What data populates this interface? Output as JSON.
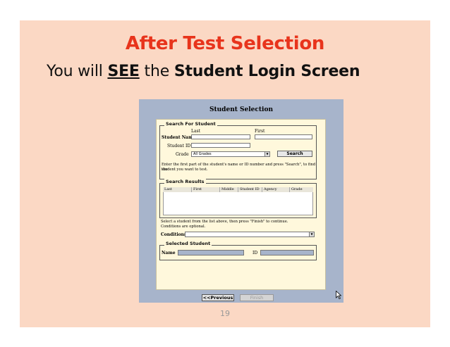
{
  "slide": {
    "title": "After Test Selection",
    "subtitle": {
      "prefix": "You will ",
      "see": "SEE",
      "middle": " the ",
      "bold": "Student Login Screen"
    },
    "page_number": "19"
  },
  "app": {
    "title": "Student Selection",
    "search": {
      "legend": "Search For Student",
      "last_label": "Last",
      "first_label": "First",
      "student_name_label": "Student Name",
      "student_id_label": "Student ID",
      "grade_label": "Grade",
      "grade_value": "All Grades",
      "search_button": "Search",
      "help_line1": "Enter the first part of the student's name or ID number and press \"Search\", to find the",
      "help_line2": "student you want to test."
    },
    "results": {
      "legend": "Search Results",
      "columns": [
        "Last",
        "First",
        "Middle",
        "Student ID",
        "Agency",
        "Grade"
      ],
      "help_line1": "Select a student from the list above, then press \"Finish\" to continue.",
      "help_line2": "Conditions are optional.",
      "conditions_label": "Conditions"
    },
    "selected": {
      "legend": "Selected Student",
      "name_label": "Name",
      "id_label": "ID"
    },
    "nav": {
      "previous_button": "<<Previous",
      "finish_button": "Finish"
    }
  }
}
